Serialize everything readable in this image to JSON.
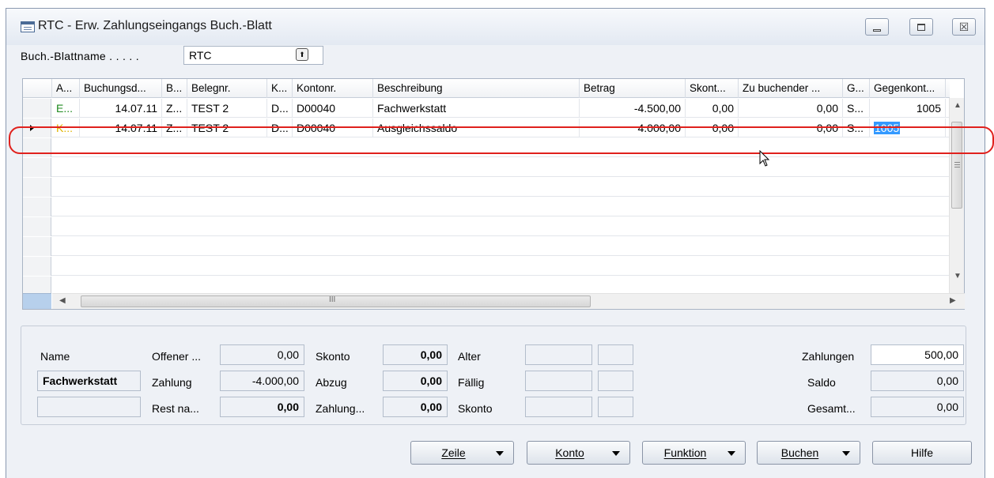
{
  "window": {
    "title": "RTC - Erw. Zahlungseingangs Buch.-Blatt",
    "close_glyph": "☒"
  },
  "journal": {
    "label": "Buch.-Blattname . . . . .",
    "value": "RTC",
    "lookup_glyph": "⬆"
  },
  "grid": {
    "columns": [
      "A...",
      "Buchungsd...",
      "B...",
      "Belegnr.",
      "K...",
      "Kontonr.",
      "Beschreibung",
      "Betrag",
      "Skont...",
      "Zu buchender ...",
      "G...",
      "Gegenkont...",
      "!"
    ],
    "rows": [
      [
        "E...",
        "14.07.11",
        "Z...",
        "TEST 2",
        "D...",
        "D00040",
        "Fachwerkstatt",
        "-4.500,00",
        "0,00",
        "0,00",
        "S...",
        "1005"
      ],
      [
        "K...",
        "14.07.11",
        "Z...",
        "TEST 2",
        "D...",
        "D00040",
        "Ausgleichssaldo",
        "4.000,00",
        "0,00",
        "0,00",
        "S...",
        "1005"
      ]
    ],
    "row_type_colors": [
      "#1f8a1f",
      "#e0b400"
    ],
    "hscroll_grip": "III"
  },
  "panel": {
    "name_label": "Name",
    "name_value": "Fachwerkstatt",
    "name_value2": "",
    "offener_label": "Offener ...",
    "offener_value": "0,00",
    "zahlung_label": "Zahlung",
    "zahlung_value": "-4.000,00",
    "rest_label": "Rest na...",
    "rest_value": "0,00",
    "skonto_label": "Skonto",
    "skonto_value": "0,00",
    "abzug_label": "Abzug",
    "abzug_value": "0,00",
    "zahlung2_label": "Zahlung...",
    "zahlung2_value": "0,00",
    "alter_label": "Alter",
    "faellig_label": "Fällig",
    "skonto2_label": "Skonto",
    "zahlungen_label": "Zahlungen",
    "zahlungen_value": "500,00",
    "saldo_label": "Saldo",
    "saldo_value": "0,00",
    "gesamt_label": "Gesamt...",
    "gesamt_value": "0,00"
  },
  "buttons": {
    "zeile": "Zeile",
    "konto": "Konto",
    "funktion": "Funktion",
    "buchen": "Buchen",
    "hilfe": "Hilfe"
  },
  "accent": "#e0211d"
}
